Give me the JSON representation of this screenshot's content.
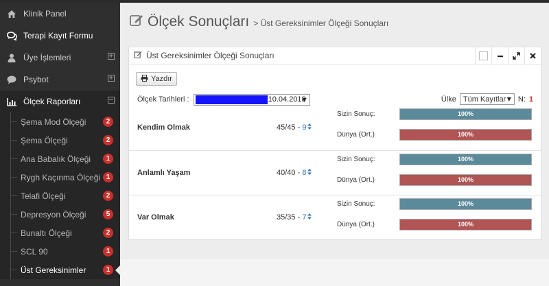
{
  "sidebar": {
    "items": [
      {
        "label": "Klinik Panel",
        "icon": "home-icon"
      },
      {
        "label": "Terapi Kayıt Formu",
        "icon": "chat-bubbles-icon"
      },
      {
        "label": "Üye İşlemleri",
        "icon": "user-icon",
        "expander": "⊞"
      },
      {
        "label": "Psybot",
        "icon": "comment-icon",
        "expander": "⊞"
      },
      {
        "label": "Ölçek Raporları",
        "icon": "bar-chart-icon",
        "expander": "⊟"
      }
    ],
    "sub_items": [
      {
        "label": "Şema Mod Ölçeği",
        "badge": "2"
      },
      {
        "label": "Şema Ölçeği",
        "badge": "2"
      },
      {
        "label": "Ana Babalık Ölçeği",
        "badge": "1"
      },
      {
        "label": "Rygh Kaçınma Ölçeği",
        "badge": "1"
      },
      {
        "label": "Telafi Ölçeği",
        "badge": "2"
      },
      {
        "label": "Depresyon Ölçeği",
        "badge": "5"
      },
      {
        "label": "Bunaltı Ölçeği",
        "badge": "2"
      },
      {
        "label": "SCL 90",
        "badge": "1"
      },
      {
        "label": "Üst Gereksinimler",
        "badge": "1"
      }
    ]
  },
  "header": {
    "title": "Ölçek Sonuçları",
    "subtitle": "> Üst Gereksinimler Ölçeği Sonuçları"
  },
  "panel": {
    "title": "Üst Gereksinimler Ölçeği Sonuçları",
    "print_label": "Yazdır",
    "date_label": "Ölçek Tarihleri :",
    "date_value": "10.04.2018",
    "country_label": "Ülke",
    "country_value": "Tüm Kayıtlar",
    "n_label": "N:",
    "n_value": "1",
    "your_result_label": "Sizin Sonuç:",
    "world_label": "Dünya (Ort.)"
  },
  "results": [
    {
      "name": "Kendim Olmak",
      "score": "45/45",
      "rank": "9",
      "your_pct": 100,
      "your_text": "100%",
      "world_pct": 100,
      "world_text": "100%"
    },
    {
      "name": "Anlamlı Yaşam",
      "score": "40/40",
      "rank": "8",
      "your_pct": 100,
      "your_text": "100%",
      "world_pct": 100,
      "world_text": "100%"
    },
    {
      "name": "Var Olmak",
      "score": "35/35",
      "rank": "7",
      "your_pct": 100,
      "your_text": "100%",
      "world_pct": 100,
      "world_text": "100%"
    }
  ],
  "colors": {
    "your_bar": "#5b8a9a",
    "world_bar": "#b05454",
    "badge": "#c9302c",
    "sidebar": "#2f2f2f"
  }
}
